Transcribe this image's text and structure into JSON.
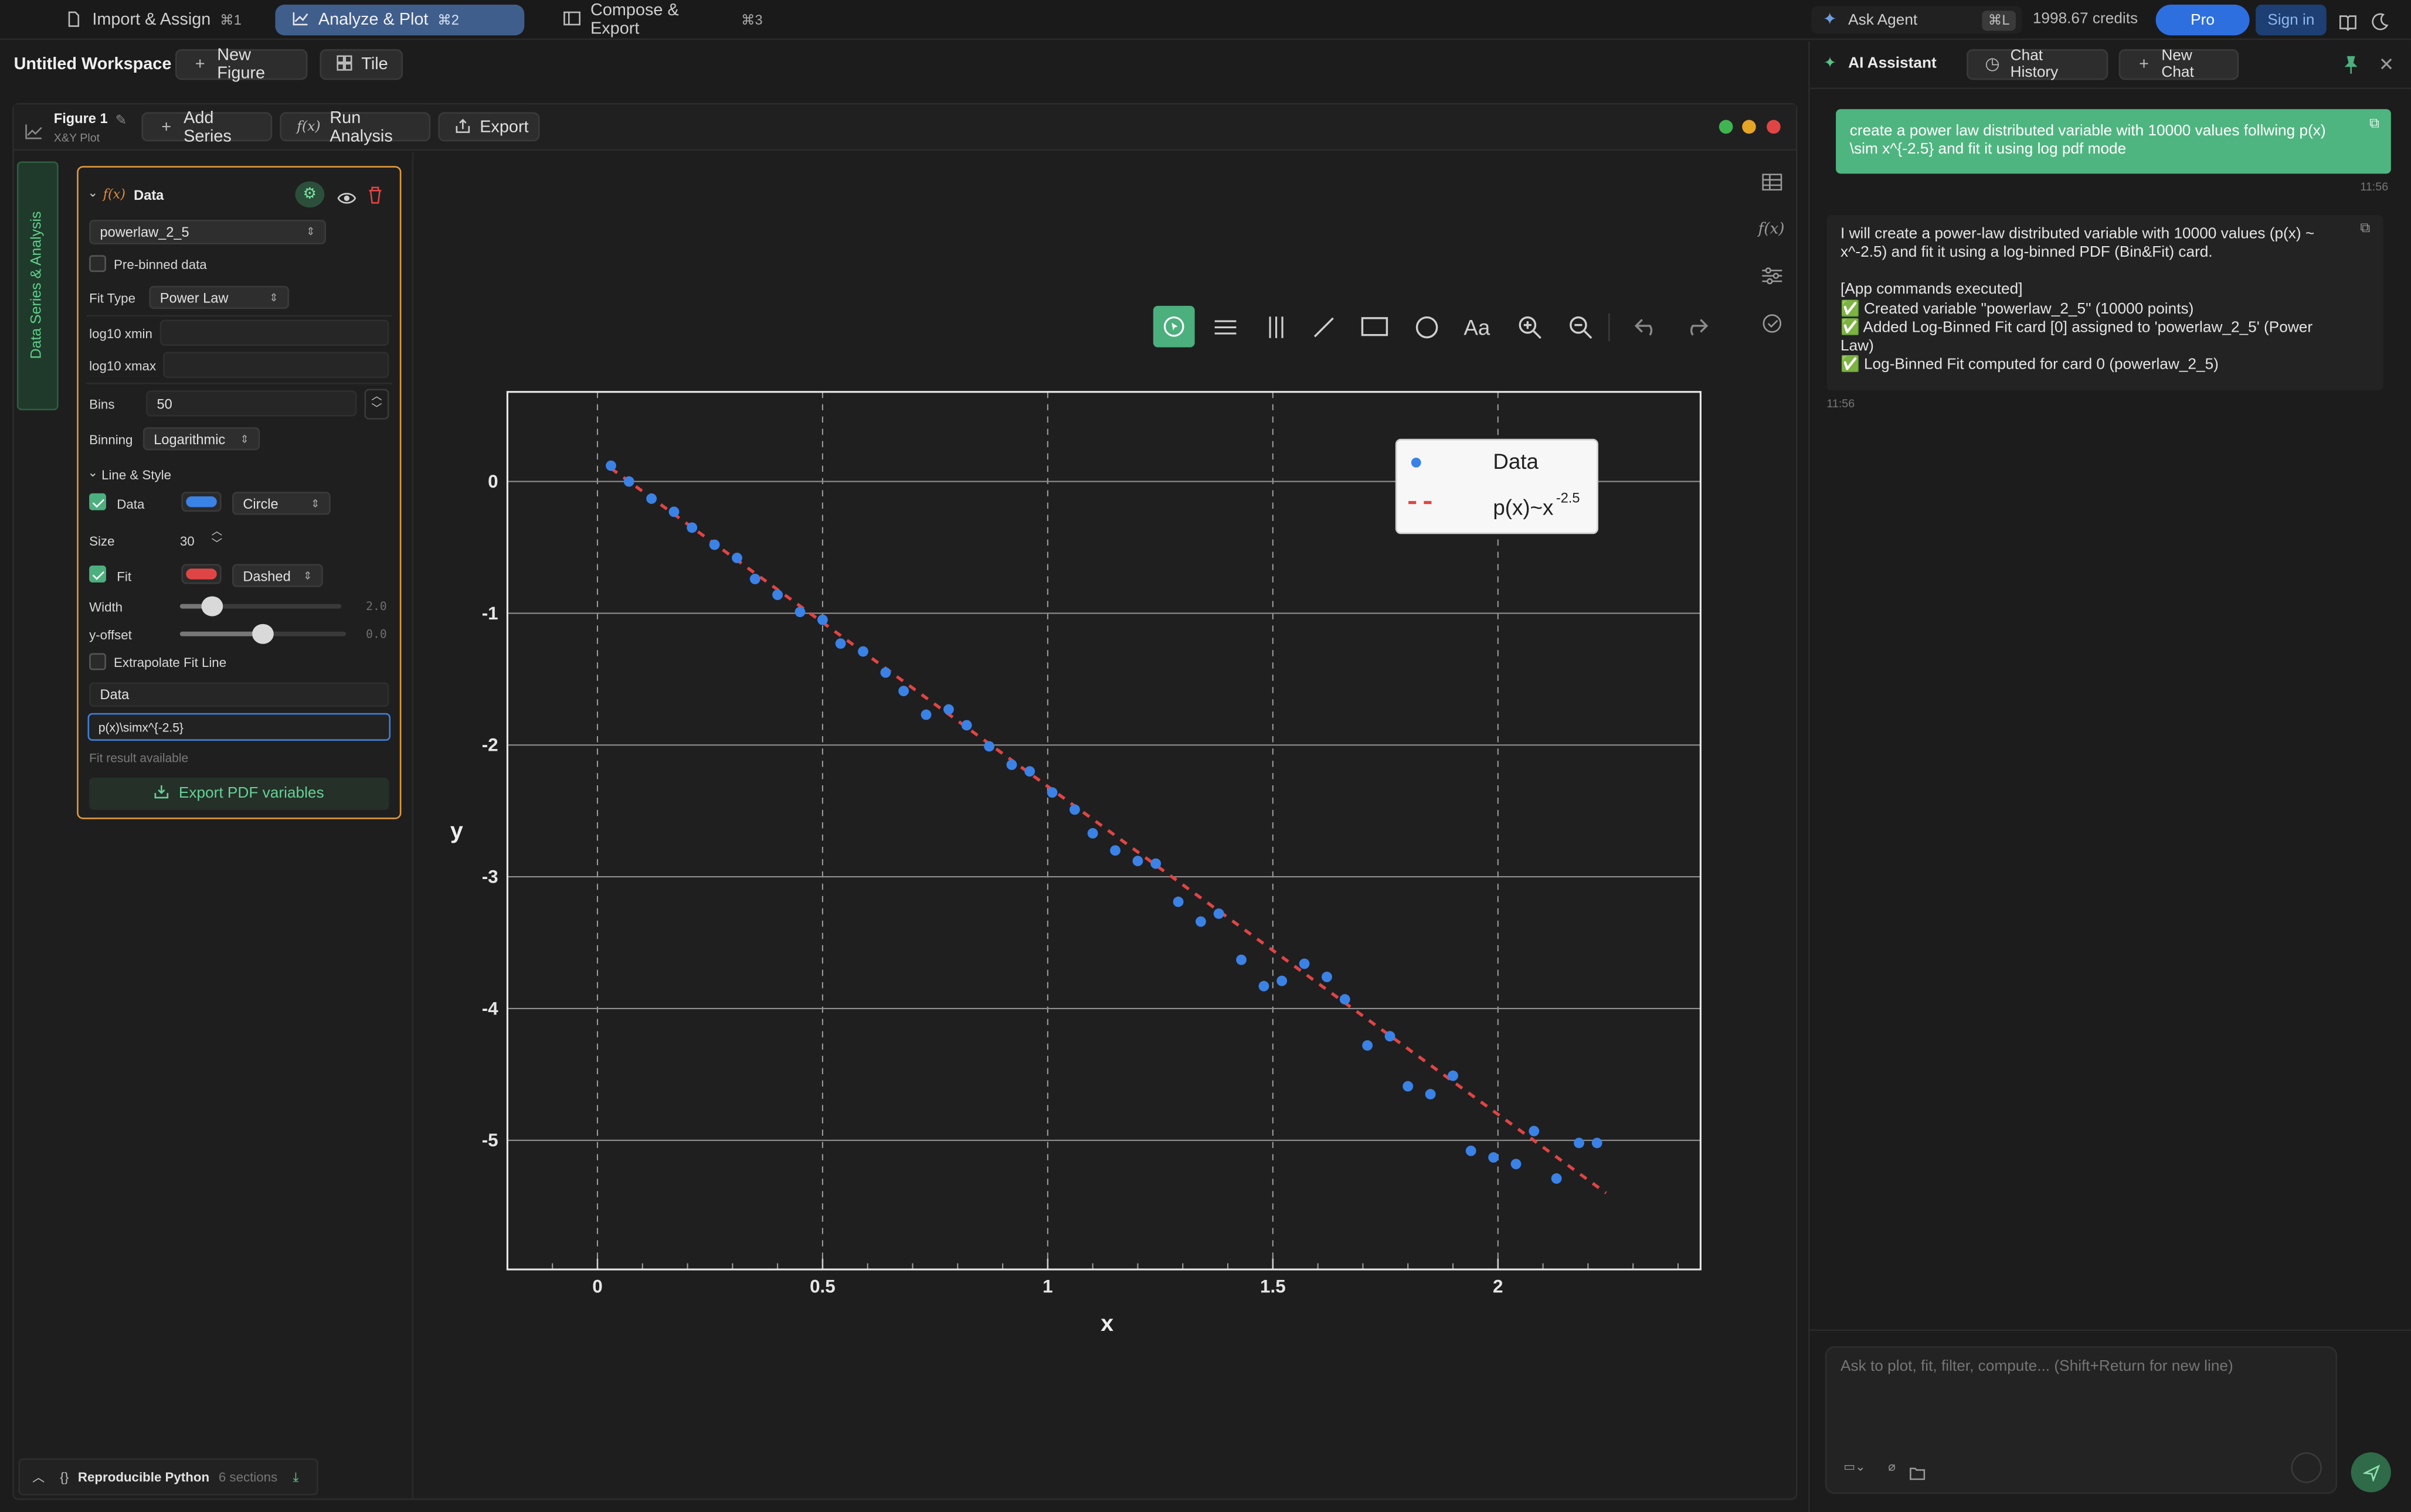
{
  "topbar": {
    "tabs": [
      {
        "label": "Import & Assign",
        "shortcut": "⌘1"
      },
      {
        "label": "Analyze & Plot",
        "shortcut": "⌘2"
      },
      {
        "label": "Compose & Export",
        "shortcut": "⌘3"
      }
    ],
    "ask_agent": "Ask Agent",
    "ask_agent_shortcut": "⌘L",
    "credits": "1998.67 credits",
    "pro": "Pro",
    "sign_in": "Sign in"
  },
  "workspace": {
    "title": "Untitled Workspace",
    "new_figure": "New Figure",
    "tile": "Tile"
  },
  "figure": {
    "name": "Figure 1",
    "subtitle": "X&Y Plot",
    "add_series": "Add Series",
    "run_analysis": "Run Analysis",
    "export": "Export",
    "fx": "f(x)"
  },
  "side_tab": "Data Series & Analysis",
  "series_card": {
    "fx": "f(x)",
    "title": "Data",
    "variable": "powerlaw_2_5",
    "pre_binned": "Pre-binned data",
    "fit_type_label": "Fit Type",
    "fit_type": "Power Law",
    "xmin_label": "log10 xmin",
    "xmax_label": "log10 xmax",
    "bins_label": "Bins",
    "bins": "50",
    "binning_label": "Binning",
    "binning": "Logarithmic",
    "line_style": "Line & Style",
    "data_label": "Data",
    "marker": "Circle",
    "size_label": "Size",
    "size": "30",
    "fit_label": "Fit",
    "linestyle": "Dashed",
    "width_label": "Width",
    "width_value": "2.0",
    "width_level": 0.2,
    "offset_label": "y-offset",
    "offset_value": "0.0",
    "offset_level": 0.5,
    "extrapolate": "Extrapolate Fit Line",
    "legend_data_field": "Data",
    "legend_fit_field": "p(x)\\simx^{-2.5}",
    "fit_status": "Fit result available",
    "export_pdf": "Export PDF variables",
    "colors": {
      "data": "#3b82e6",
      "fit": "#e04545"
    }
  },
  "footer": {
    "label": "Reproducible Python",
    "sections": "6 sections"
  },
  "chart_data": {
    "type": "scatter",
    "xlabel": "x",
    "ylabel": "y",
    "xlim": [
      -0.2,
      2.45
    ],
    "ylim": [
      -5.98,
      0.68
    ],
    "xticks": [
      "0",
      "0.5",
      "1",
      "1.5",
      "2"
    ],
    "yticks": [
      "0",
      "-1",
      "-2",
      "-3",
      "-4",
      "-5"
    ],
    "grid": true,
    "legend": {
      "position": "top-right",
      "data": "Data",
      "fit_base": "p(x)~x",
      "fit_exp": "-2.5"
    },
    "series": [
      {
        "name": "Data",
        "kind": "scatter",
        "color": "#3b82e6",
        "x": [
          0.03,
          0.07,
          0.12,
          0.17,
          0.21,
          0.26,
          0.31,
          0.35,
          0.4,
          0.45,
          0.5,
          0.54,
          0.59,
          0.64,
          0.68,
          0.73,
          0.78,
          0.82,
          0.87,
          0.92,
          0.96,
          1.01,
          1.06,
          1.1,
          1.15,
          1.2,
          1.24,
          1.29,
          1.34,
          1.38,
          1.43,
          1.48,
          1.52,
          1.57,
          1.62,
          1.66,
          1.71,
          1.76,
          1.8,
          1.85,
          1.9,
          1.94,
          1.99,
          2.04,
          2.08,
          2.13,
          2.18,
          2.22
        ],
        "y": [
          0.12,
          0.0,
          -0.13,
          -0.23,
          -0.35,
          -0.48,
          -0.58,
          -0.74,
          -0.86,
          -0.99,
          -1.05,
          -1.23,
          -1.29,
          -1.45,
          -1.59,
          -1.77,
          -1.73,
          -1.85,
          -2.01,
          -2.15,
          -2.2,
          -2.36,
          -2.49,
          -2.67,
          -2.8,
          -2.88,
          -2.9,
          -3.19,
          -3.34,
          -3.28,
          -3.63,
          -3.83,
          -3.79,
          -3.66,
          -3.76,
          -3.93,
          -4.28,
          -4.21,
          -4.59,
          -4.65,
          -4.51,
          -5.08,
          -5.13,
          -5.18,
          -4.93,
          -5.29,
          -5.02,
          -5.02
        ]
      },
      {
        "name": "p(x)~x^-2.5",
        "kind": "dashed-line",
        "color": "#e04545",
        "x": [
          0.03,
          2.24
        ],
        "y": [
          0.1,
          -5.4
        ]
      }
    ]
  },
  "assistant": {
    "title": "AI Assistant",
    "chat_history": "Chat History",
    "new_chat": "New Chat",
    "user_message": "create a power law distributed variable with 10000 values follwing p(x) \\sim x^{-2.5}  and fit it using log pdf mode",
    "user_time": "11:56",
    "reply_lines": [
      "I will create a power-law distributed variable with 10000 values (p(x) ~ x^-2.5) and fit it using a log-binned PDF (Bin&Fit) card.",
      "",
      "[App commands executed]",
      "✅ Created variable \"powerlaw_2_5\" (10000 points)",
      "✅ Added Log-Binned Fit card [0] assigned to 'powerlaw_2_5' (Power Law)",
      "✅ Log-Binned Fit computed for card 0 (powerlaw_2_5)"
    ],
    "reply_time": "11:56",
    "input_placeholder": "Ask to plot, fit, filter, compute... (Shift+Return for new line)"
  }
}
